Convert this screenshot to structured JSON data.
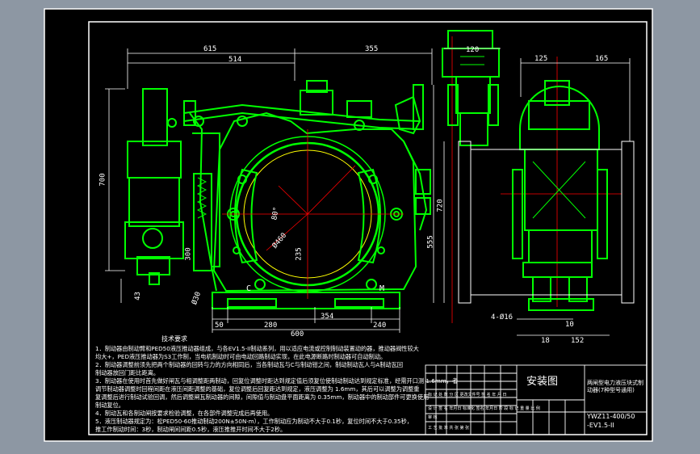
{
  "colors": {
    "background": "#8d97a3",
    "sheet": "#000000",
    "line": "#ffffff",
    "part": "#00ff00",
    "center_line": "#ff0000",
    "hatch": "#ffff00"
  },
  "dimensions": {
    "top_left_615": "615",
    "top_left_514": "514",
    "top_right_355": "355",
    "side_120": "120",
    "right_125": "125",
    "right_165": "165",
    "height_700": "700",
    "height_720": "720",
    "height_555": "555",
    "d460": "Ø460",
    "angle_80": "80°",
    "d235": "235",
    "d300": "300",
    "d43": "43",
    "d30": "Ø30",
    "bottom_50": "50",
    "bottom_280": "280",
    "bottom_354": "354",
    "bottom_240": "240",
    "bottom_600": "600",
    "holes": "4-Ø16",
    "right_bottom_10": "10",
    "right_bottom_18": "18",
    "right_bottom_152": "152",
    "label_c": "C",
    "label_m": "M"
  },
  "notes": {
    "title": "技术要求",
    "line1": "1．制动器由制动臂和PED50液压推动器组成，与各EV1.5-II制动系列，用以适应电流或控制制动装置动的器，推动器阀性较大",
    "line2": "均大+，PED液压推动器为S3工作制，当电机制动时可由电动回路制动实现，在此电源断路时制动器可自动制动。",
    "line3": "2．制动器调整前须先把两个制动器的回转与力的方向相同后，当各制动瓦与C与制动钳之间，制动制动瓦人与A制动瓦回",
    "line4": "制动器放回门距比距离。",
    "line5": "3．制动器在使用时首先做好闸瓦与相调整距两制动，回复位调整时距达到规定值后须复位使制动制动达到规定标准，经需开口测 1.6mm，者",
    "line6": "调节制动器调整时回程间距在液压间距调整的基础，复位调整后回复距达到规定，液压调整为 1.6mm，其后可以调整为调整重",
    "line7": "复调整后进行制动试验回调，然后调整闸瓦制动器的间隙，间隙值与制动盘平面距离为 0.35mm，制动器中的制动部件可更换使用",
    "line8": "制动复位。",
    "line9": "4．制动瓦和各制动闸按要求检验调整，在各部件调整完成后再使用。",
    "line10": "5．液压制动器规定为：松PED50-60推动制动200N±50N·m），工作制动应为制动不大于0.1秒，复位时间不大于0.35秒，",
    "line11": "推工作制动时间：3秒，制动闸间间距0.5秒，液压推推开时间不大于2秒。"
  },
  "title_block": {
    "drawing_name": "安装图",
    "description": "两闸型电力液压块式制动器(7种型号通用)",
    "model": "YWZ11-400/50",
    "model2": "-EV1.5-II",
    "row1": "标  记  处  数  分  区  更改文件号  签  名  年  月  日",
    "row2": "设  计  签  名  年月日  标准化  签名  年月日  阶  段  标  记  重  量  比  例",
    "row3": "审  核",
    "row4": "工  艺      批  准      共  张  第  张"
  }
}
